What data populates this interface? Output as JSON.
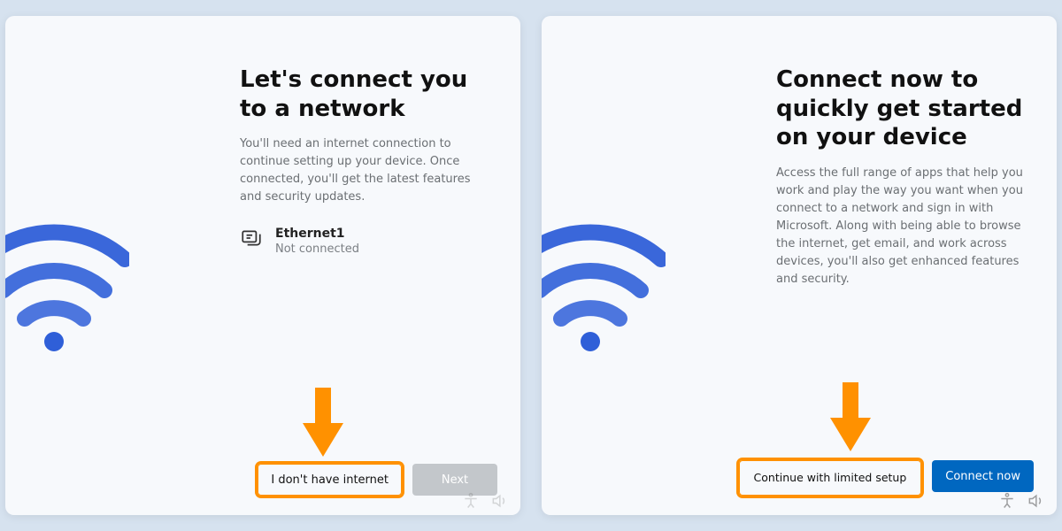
{
  "left": {
    "title": "Let's connect you to a network",
    "description": "You'll need an internet connection to continue setting up your device. Once connected, you'll get the latest features and security updates.",
    "ethernet": {
      "name": "Ethernet1",
      "status": "Not connected"
    },
    "buttons": {
      "no_internet": "I don't have internet",
      "next": "Next"
    }
  },
  "right": {
    "title": "Connect now to quickly get started on your device",
    "description": "Access the full range of apps that help you work and play the way you want when you connect to a network and sign in with Microsoft. Along with being able to browse the internet, get email, and work across devices, you'll also get enhanced features and security.",
    "buttons": {
      "limited": "Continue with limited setup",
      "connect": "Connect now"
    }
  },
  "colors": {
    "accent": "#0067c0",
    "highlight": "#ff9100",
    "wifi": "#2f5fd8"
  }
}
